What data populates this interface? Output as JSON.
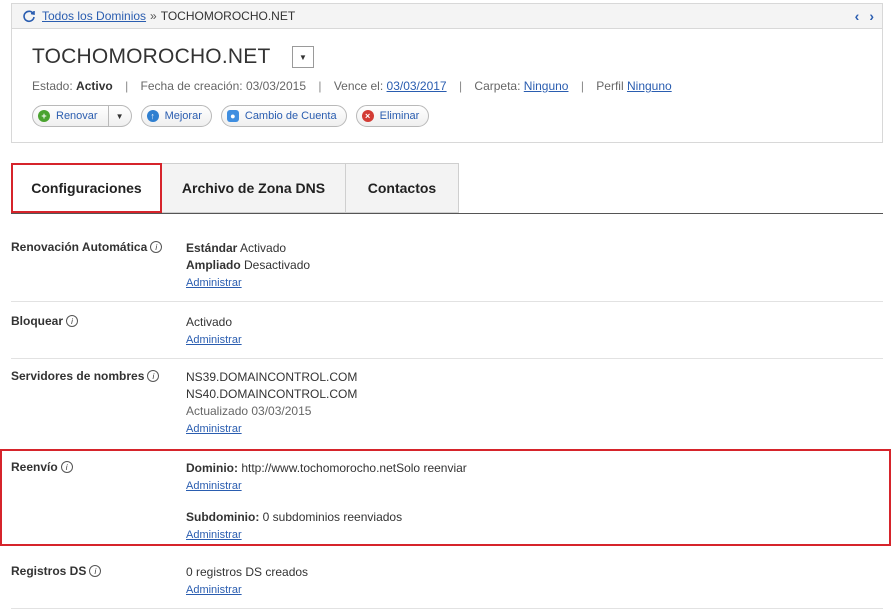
{
  "breadcrumb": {
    "all_domains": "Todos los Dominios",
    "separator": "»",
    "current": "TOCHOMOROCHO.NET"
  },
  "header": {
    "title": "TOCHOMOROCHO.NET",
    "estado_label": "Estado:",
    "estado_value": "Activo",
    "fecha_label": "Fecha de creación: 03/03/2015",
    "vence_label": "Vence el:",
    "vence_value": "03/03/2017",
    "carpeta_label": "Carpeta:",
    "carpeta_value": "Ninguno",
    "perfil_label": "Perfil",
    "perfil_value": "Ninguno"
  },
  "actions": {
    "renovar": "Renovar",
    "mejorar": "Mejorar",
    "cambio": "Cambio de Cuenta",
    "eliminar": "Eliminar"
  },
  "tabs": [
    "Configuraciones",
    "Archivo de Zona DNS",
    "Contactos"
  ],
  "settings": {
    "renovacion": {
      "label": "Renovación Automática",
      "std_label": "Estándar",
      "std_value": "Activado",
      "amp_label": "Ampliado",
      "amp_value": "Desactivado",
      "manage": "Administrar"
    },
    "bloquear": {
      "label": "Bloquear",
      "value": "Activado",
      "manage": "Administrar"
    },
    "servidores": {
      "label": "Servidores de nombres",
      "ns1": "NS39.DOMAINCONTROL.COM",
      "ns2": "NS40.DOMAINCONTROL.COM",
      "updated": "Actualizado 03/03/2015",
      "manage": "Administrar"
    },
    "reenvio": {
      "label": "Reenvío",
      "dom_label": "Dominio:",
      "dom_value": "http://www.tochomorocho.netSolo reenviar",
      "manage1": "Administrar",
      "sub_label": "Subdominio:",
      "sub_value": "0 subdominios reenviados",
      "manage2": "Administrar"
    },
    "ds": {
      "label": "Registros DS",
      "value": "0 registros DS creados",
      "manage": "Administrar"
    }
  },
  "colors": {
    "accent": "#d6242b",
    "link": "#2a5db0"
  }
}
